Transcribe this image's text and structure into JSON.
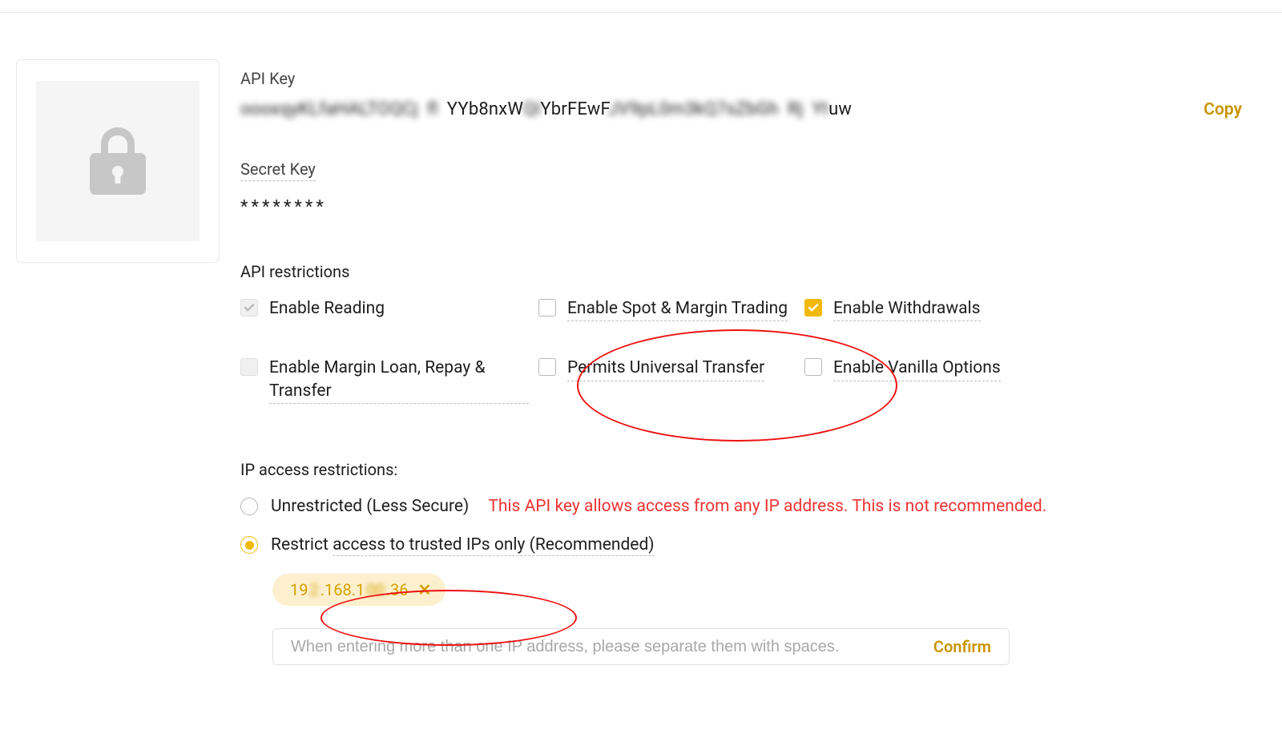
{
  "apiKey": {
    "label": "API Key",
    "prefix": "ooox",
    "mid1": "qyKLfaHALTO",
    "mid2": "YYb8nxW",
    "mid3": "YbrFEwF",
    "suffix": "uw",
    "copy": "Copy"
  },
  "secretKey": {
    "label": "Secret Key",
    "masked": "********"
  },
  "restrictions": {
    "label": "API restrictions",
    "items": {
      "reading": "Enable Reading",
      "spot": "Enable Spot & Margin Trading",
      "withdraw": "Enable Withdrawals",
      "margin": "Enable Margin Loan, Repay & Transfer",
      "universal": "Permits Universal Transfer",
      "vanilla": "Enable Vanilla Options"
    }
  },
  "ip": {
    "label": "IP access restrictions:",
    "unrestricted": "Unrestricted (Less Secure)",
    "warn": "This API key allows access from any IP address. This is not recommended.",
    "restrict_pre": "Restrict ",
    "restrict_dash": "access to trusted IPs only (Recommended)",
    "chip": {
      "a": "19",
      "b": ".168.1",
      "c": ".36"
    },
    "placeholder": "When entering more than one IP address, please separate them with spaces.",
    "confirm": "Confirm"
  }
}
